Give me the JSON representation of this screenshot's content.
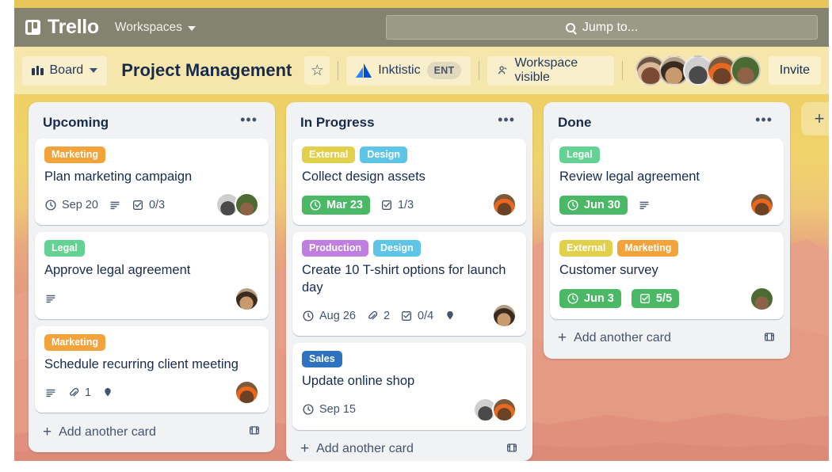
{
  "topnav": {
    "brand": "Trello",
    "workspaces_label": "Workspaces",
    "search_placeholder": "Jump to...",
    "search_icon": "search-icon",
    "chevron_icon": "chevron-down-icon",
    "bg_color": "#83836f"
  },
  "boardbar": {
    "view_label": "Board",
    "view_icon": "board-icon",
    "title": "Project Management",
    "star_icon": "star-icon",
    "workspace_name": "Inktistic",
    "workspace_badge": "ENT",
    "workspace_logo_icon": "atlassian-logo-icon",
    "visibility_label": "Workspace visible",
    "visibility_icon": "person-visible-icon",
    "invite_label": "Invite",
    "members": [
      {
        "name": "member-1"
      },
      {
        "name": "member-2"
      },
      {
        "name": "member-3"
      },
      {
        "name": "member-4"
      },
      {
        "name": "member-5"
      }
    ]
  },
  "board": {
    "add_list_label": "+",
    "add_card_label": "Add another card",
    "card_template_icon": "card-template-icon",
    "list_menu_icon": "list-actions-icon",
    "label_colors": {
      "Marketing": "#f2a33c",
      "Legal": "#63d292",
      "External": "#e2d04c",
      "Design": "#5ec5e8",
      "Production": "#c07fe0",
      "Sales": "#2f73c0"
    },
    "due_badge_color": "#4bb866",
    "lists": [
      {
        "title": "Upcoming",
        "cards": [
          {
            "labels": [
              "Marketing"
            ],
            "title": "Plan marketing campaign",
            "due": "Sep 20",
            "due_done": false,
            "description": true,
            "attachments": null,
            "checklist": "0/3",
            "checklist_done": false,
            "location": false,
            "avatars": [
              "av-c",
              "av-e"
            ]
          },
          {
            "labels": [
              "Legal"
            ],
            "title": "Approve legal agreement",
            "due": null,
            "due_done": false,
            "description": true,
            "attachments": null,
            "checklist": null,
            "checklist_done": false,
            "location": false,
            "avatars": [
              "av-b"
            ]
          },
          {
            "labels": [
              "Marketing"
            ],
            "title": "Schedule recurring client meeting",
            "due": null,
            "due_done": false,
            "description": true,
            "attachments": "1",
            "checklist": null,
            "checklist_done": false,
            "location": true,
            "avatars": [
              "av-d"
            ]
          }
        ]
      },
      {
        "title": "In Progress",
        "cards": [
          {
            "labels": [
              "External",
              "Design"
            ],
            "title": "Collect design assets",
            "due": "Mar 23",
            "due_done": true,
            "description": false,
            "attachments": null,
            "checklist": "1/3",
            "checklist_done": false,
            "location": false,
            "avatars": [
              "av-d"
            ]
          },
          {
            "labels": [
              "Production",
              "Design"
            ],
            "title": "Create 10 T-shirt options for launch day",
            "due": "Aug 26",
            "due_done": false,
            "description": false,
            "attachments": "2",
            "checklist": "0/4",
            "checklist_done": false,
            "location": true,
            "avatars": [
              "av-b"
            ]
          },
          {
            "labels": [
              "Sales"
            ],
            "title": "Update online shop",
            "due": "Sep 15",
            "due_done": false,
            "description": false,
            "attachments": null,
            "checklist": null,
            "checklist_done": false,
            "location": false,
            "avatars": [
              "av-c",
              "av-d"
            ]
          }
        ]
      },
      {
        "title": "Done",
        "cards": [
          {
            "labels": [
              "Legal"
            ],
            "title": "Review legal agreement",
            "due": "Jun 30",
            "due_done": true,
            "description": true,
            "attachments": null,
            "checklist": null,
            "checklist_done": false,
            "location": false,
            "avatars": [
              "av-d"
            ]
          },
          {
            "labels": [
              "External",
              "Marketing"
            ],
            "title": "Customer survey",
            "due": "Jun 3",
            "due_done": true,
            "description": false,
            "attachments": null,
            "checklist": "5/5",
            "checklist_done": true,
            "location": false,
            "avatars": [
              "av-e"
            ]
          }
        ]
      }
    ]
  }
}
